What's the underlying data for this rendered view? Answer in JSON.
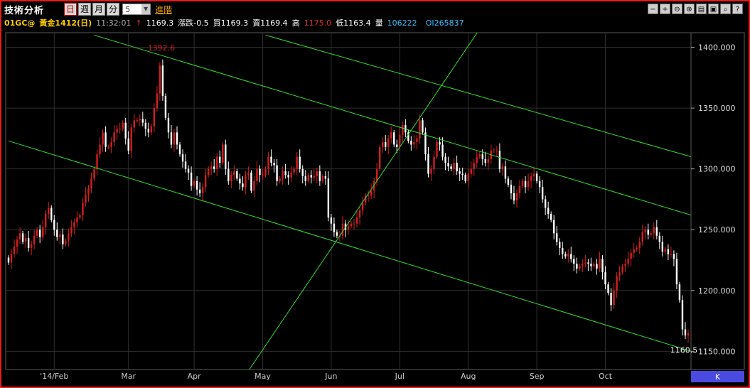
{
  "toolbar": {
    "title": "技術分析",
    "periods": [
      "日",
      "週",
      "月",
      "分"
    ],
    "active_period": "日",
    "interval_value": "5",
    "advanced_label": "進階",
    "tools": [
      "minus-icon",
      "plus-icon",
      "zoom-out-icon",
      "zoom-in-icon",
      "print-icon",
      "save-icon",
      "search-icon",
      "help-icon"
    ]
  },
  "quote": {
    "symbol": "01GC@",
    "name": "黃金1412(日)",
    "time": "11:32:01",
    "arrow": "↑",
    "last": "1169.3",
    "change": "漲跌-0.5",
    "bid": "買1169.3",
    "ask": "賣1169.4",
    "high_label": "高",
    "high": "1175.0",
    "low": "低1163.4",
    "volume_label": "量",
    "volume": "106222",
    "oi": "OI265837"
  },
  "colors": {
    "up": "#d41e1e",
    "down": "#ffffff",
    "trendline": "#33dd33",
    "grid": "#2f2f2f",
    "frame": "#e31e1e",
    "axis_panel": "#4a4ae0"
  },
  "chart_data": {
    "type": "candlestick",
    "y_axis": {
      "min": 1135,
      "max": 1412,
      "ticks": [
        "1150.000",
        "1200.000",
        "1250.000",
        "1300.000",
        "1350.000",
        "1400.000"
      ],
      "position": "right"
    },
    "x_axis": {
      "labels": [
        "'14/Feb",
        "Mar",
        "Apr",
        "May",
        "Jun",
        "Jul",
        "Aug",
        "Sep",
        "Oct"
      ],
      "period_label": "K"
    },
    "annotations": [
      {
        "text": "1392.6",
        "bar": 54,
        "value": 1392.6
      },
      {
        "text": "1160.5",
        "bar": 238,
        "value": 1160.5
      }
    ],
    "trendlines": [
      {
        "from": [
          0,
          1323
        ],
        "to": [
          239,
          1150
        ]
      },
      {
        "from": [
          30,
          1410
        ],
        "to": [
          239,
          1262
        ]
      },
      {
        "from": [
          90,
          1410
        ],
        "to": [
          239,
          1310
        ]
      },
      {
        "from": [
          80,
          1120
        ],
        "to": [
          165,
          1415
        ]
      }
    ],
    "months": [
      {
        "label": "'14/Feb",
        "bar": 16
      },
      {
        "label": "Mar",
        "bar": 42
      },
      {
        "label": "Apr",
        "bar": 65
      },
      {
        "label": "May",
        "bar": 89
      },
      {
        "label": "Jun",
        "bar": 113
      },
      {
        "label": "Jul",
        "bar": 137
      },
      {
        "label": "Aug",
        "bar": 161
      },
      {
        "label": "Sep",
        "bar": 185
      },
      {
        "label": "Oct",
        "bar": 209
      }
    ],
    "closes": [
      1223,
      1230,
      1236,
      1242,
      1247,
      1240,
      1243,
      1235,
      1238,
      1245,
      1250,
      1244,
      1252,
      1263,
      1268,
      1258,
      1250,
      1244,
      1246,
      1238,
      1241,
      1247,
      1252,
      1256,
      1260,
      1262,
      1272,
      1279,
      1284,
      1292,
      1300,
      1312,
      1320,
      1330,
      1318,
      1318,
      1322,
      1330,
      1333,
      1333,
      1338,
      1325,
      1315,
      1334,
      1340,
      1340,
      1341,
      1338,
      1333,
      1330,
      1335,
      1350,
      1362,
      1385,
      1360,
      1342,
      1330,
      1320,
      1330,
      1320,
      1312,
      1306,
      1300,
      1297,
      1286,
      1290,
      1283,
      1280,
      1285,
      1295,
      1300,
      1302,
      1300,
      1310,
      1305,
      1320,
      1300,
      1290,
      1295,
      1298,
      1292,
      1288,
      1285,
      1295,
      1297,
      1282,
      1290,
      1300,
      1295,
      1295,
      1300,
      1310,
      1305,
      1303,
      1290,
      1292,
      1298,
      1295,
      1293,
      1297,
      1300,
      1310,
      1300,
      1294,
      1290,
      1295,
      1293,
      1294,
      1298,
      1290,
      1294,
      1292,
      1260,
      1255,
      1248,
      1245,
      1245,
      1255,
      1250,
      1253,
      1255,
      1255,
      1260,
      1266,
      1272,
      1278,
      1278,
      1282,
      1290,
      1300,
      1318,
      1322,
      1318,
      1325,
      1330,
      1320,
      1318,
      1328,
      1336,
      1330,
      1323,
      1320,
      1322,
      1325,
      1340,
      1330,
      1312,
      1296,
      1300,
      1310,
      1322,
      1320,
      1310,
      1305,
      1302,
      1300,
      1305,
      1298,
      1296,
      1295,
      1290,
      1296,
      1300,
      1305,
      1310,
      1312,
      1308,
      1305,
      1308,
      1315,
      1315,
      1315,
      1300,
      1302,
      1292,
      1287,
      1280,
      1274,
      1280,
      1286,
      1290,
      1285,
      1290,
      1294,
      1296,
      1290,
      1285,
      1275,
      1268,
      1263,
      1258,
      1247,
      1240,
      1235,
      1230,
      1228,
      1230,
      1226,
      1222,
      1218,
      1220,
      1222,
      1223,
      1222,
      1220,
      1222,
      1218,
      1226,
      1215,
      1205,
      1198,
      1188,
      1200,
      1212,
      1215,
      1220,
      1222,
      1226,
      1231,
      1234,
      1235,
      1240,
      1248,
      1250,
      1246,
      1247,
      1252,
      1245,
      1240,
      1232,
      1234,
      1230,
      1230,
      1226,
      1205,
      1192,
      1168,
      1163,
      1165
    ]
  }
}
